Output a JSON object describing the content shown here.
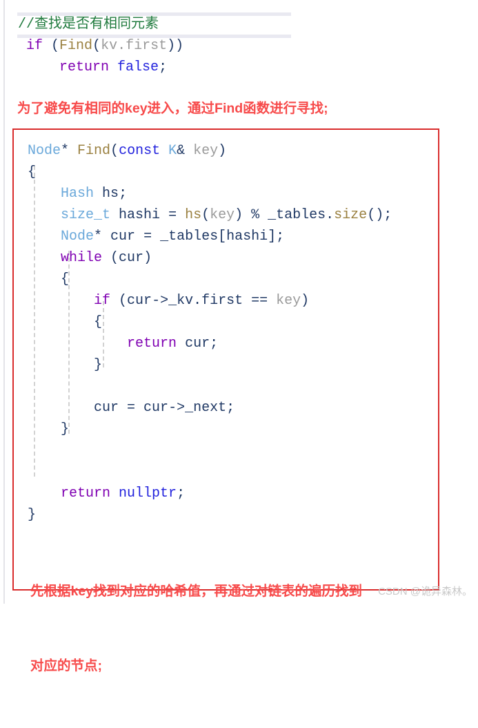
{
  "page": {
    "background_color": "#ffffff",
    "left_rule_color": "#e3e3e8"
  },
  "top_snippet": {
    "highlight_color": "#e9e9f1",
    "lines": [
      {
        "tokens": [
          {
            "text": "//查找是否有相同元素",
            "cls": "t-comment"
          }
        ]
      },
      {
        "tokens": [
          {
            "text": " if",
            "cls": "t-kw"
          },
          {
            "text": " (",
            "cls": "t-punct"
          },
          {
            "text": "Find",
            "cls": "t-fn"
          },
          {
            "text": "(",
            "cls": "t-punct"
          },
          {
            "text": "kv.first",
            "cls": "t-gray"
          },
          {
            "text": "))",
            "cls": "t-punct"
          }
        ]
      },
      {
        "tokens": [
          {
            "text": "     return",
            "cls": "t-kw"
          },
          {
            "text": " ",
            "cls": "t-punct"
          },
          {
            "text": "false",
            "cls": "t-kw2"
          },
          {
            "text": ";",
            "cls": "t-punct"
          }
        ]
      }
    ]
  },
  "annotation_top": {
    "text": "为了避免有相同的key进入，通过Find函数进行寻找;",
    "color": "#f74a4a"
  },
  "code_box": {
    "border_color": "#d92b2b",
    "indent_guide_color": "#d2d2d2",
    "lines": [
      {
        "tokens": [
          {
            "text": "Node",
            "cls": "t-type"
          },
          {
            "text": "* ",
            "cls": "t-punct"
          },
          {
            "text": "Find",
            "cls": "t-fn"
          },
          {
            "text": "(",
            "cls": "t-punct"
          },
          {
            "text": "const",
            "cls": "t-kw2"
          },
          {
            "text": " ",
            "cls": "t-punct"
          },
          {
            "text": "K",
            "cls": "t-type"
          },
          {
            "text": "& ",
            "cls": "t-punct"
          },
          {
            "text": "key",
            "cls": "t-gray"
          },
          {
            "text": ")",
            "cls": "t-punct"
          }
        ]
      },
      {
        "tokens": [
          {
            "text": "{",
            "cls": "t-brace"
          }
        ]
      },
      {
        "tokens": [
          {
            "text": "    ",
            "cls": "t-punct"
          },
          {
            "text": "Hash",
            "cls": "t-type"
          },
          {
            "text": " ",
            "cls": "t-punct"
          },
          {
            "text": "hs",
            "cls": "t-var"
          },
          {
            "text": ";",
            "cls": "t-punct"
          }
        ]
      },
      {
        "tokens": [
          {
            "text": "    ",
            "cls": "t-punct"
          },
          {
            "text": "size_t",
            "cls": "t-type"
          },
          {
            "text": " ",
            "cls": "t-punct"
          },
          {
            "text": "hashi",
            "cls": "t-var"
          },
          {
            "text": " = ",
            "cls": "t-punct"
          },
          {
            "text": "hs",
            "cls": "t-fn"
          },
          {
            "text": "(",
            "cls": "t-punct"
          },
          {
            "text": "key",
            "cls": "t-gray"
          },
          {
            "text": ") % ",
            "cls": "t-punct"
          },
          {
            "text": "_tables",
            "cls": "t-var"
          },
          {
            "text": ".",
            "cls": "t-punct"
          },
          {
            "text": "size",
            "cls": "t-fn"
          },
          {
            "text": "();",
            "cls": "t-punct"
          }
        ]
      },
      {
        "tokens": [
          {
            "text": "    ",
            "cls": "t-punct"
          },
          {
            "text": "Node",
            "cls": "t-type"
          },
          {
            "text": "* ",
            "cls": "t-punct"
          },
          {
            "text": "cur",
            "cls": "t-var"
          },
          {
            "text": " = ",
            "cls": "t-punct"
          },
          {
            "text": "_tables",
            "cls": "t-var"
          },
          {
            "text": "[",
            "cls": "t-punct"
          },
          {
            "text": "hashi",
            "cls": "t-var"
          },
          {
            "text": "];",
            "cls": "t-punct"
          }
        ]
      },
      {
        "tokens": [
          {
            "text": "    ",
            "cls": "t-punct"
          },
          {
            "text": "while",
            "cls": "t-kw"
          },
          {
            "text": " (",
            "cls": "t-punct"
          },
          {
            "text": "cur",
            "cls": "t-var"
          },
          {
            "text": ")",
            "cls": "t-punct"
          }
        ]
      },
      {
        "tokens": [
          {
            "text": "    {",
            "cls": "t-brace"
          }
        ]
      },
      {
        "tokens": [
          {
            "text": "        ",
            "cls": "t-punct"
          },
          {
            "text": "if",
            "cls": "t-kw"
          },
          {
            "text": " (",
            "cls": "t-punct"
          },
          {
            "text": "cur",
            "cls": "t-var"
          },
          {
            "text": "->",
            "cls": "t-punct"
          },
          {
            "text": "_kv",
            "cls": "t-var"
          },
          {
            "text": ".",
            "cls": "t-punct"
          },
          {
            "text": "first",
            "cls": "t-var"
          },
          {
            "text": " == ",
            "cls": "t-punct"
          },
          {
            "text": "key",
            "cls": "t-gray"
          },
          {
            "text": ")",
            "cls": "t-punct"
          }
        ]
      },
      {
        "tokens": [
          {
            "text": "        {",
            "cls": "t-brace"
          }
        ]
      },
      {
        "tokens": [
          {
            "text": "            ",
            "cls": "t-punct"
          },
          {
            "text": "return",
            "cls": "t-kw"
          },
          {
            "text": " ",
            "cls": "t-punct"
          },
          {
            "text": "cur",
            "cls": "t-var"
          },
          {
            "text": ";",
            "cls": "t-punct"
          }
        ]
      },
      {
        "tokens": [
          {
            "text": "        }",
            "cls": "t-brace"
          }
        ]
      },
      {
        "tokens": [
          {
            "text": "",
            "cls": "t-punct"
          }
        ]
      },
      {
        "tokens": [
          {
            "text": "        ",
            "cls": "t-punct"
          },
          {
            "text": "cur",
            "cls": "t-var"
          },
          {
            "text": " = ",
            "cls": "t-punct"
          },
          {
            "text": "cur",
            "cls": "t-var"
          },
          {
            "text": "->",
            "cls": "t-punct"
          },
          {
            "text": "_next",
            "cls": "t-var"
          },
          {
            "text": ";",
            "cls": "t-punct"
          }
        ]
      },
      {
        "tokens": [
          {
            "text": "    }",
            "cls": "t-brace"
          }
        ]
      },
      {
        "tokens": [
          {
            "text": "",
            "cls": "t-punct"
          }
        ]
      },
      {
        "tokens": [
          {
            "text": "",
            "cls": "t-punct"
          }
        ]
      },
      {
        "tokens": [
          {
            "text": "    ",
            "cls": "t-punct"
          },
          {
            "text": "return",
            "cls": "t-kw"
          },
          {
            "text": " ",
            "cls": "t-punct"
          },
          {
            "text": "nullptr",
            "cls": "t-kw2"
          },
          {
            "text": ";",
            "cls": "t-punct"
          }
        ]
      },
      {
        "tokens": [
          {
            "text": "}",
            "cls": "t-brace"
          }
        ]
      }
    ]
  },
  "annotation_bottom": {
    "line1": "先根据key找到对应的哈希值，再通过对链表的遍历找到",
    "line2": "对应的节点;",
    "color": "#f74a4a"
  },
  "watermark": {
    "text": "CSDN @诡异森林。",
    "color": "#c9c9c9"
  }
}
